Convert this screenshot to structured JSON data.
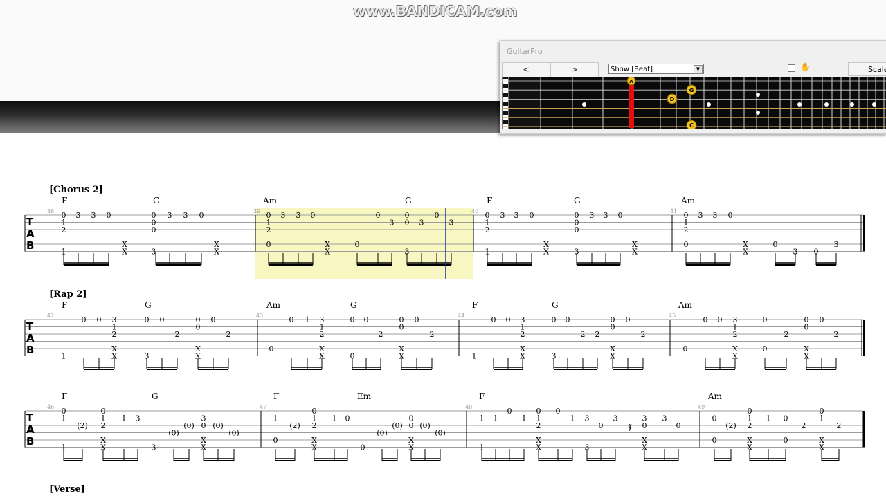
{
  "watermark": "www.BANDICAM.com",
  "guitarpro": {
    "title": "GuitarPro",
    "prev_label": "<",
    "next_label": ">",
    "view_select": "Show [Beat]",
    "scales_label": "Scales",
    "markers": [
      "A",
      "D",
      "G",
      "C"
    ]
  },
  "sections": {
    "chorus2": "[Chorus 2]",
    "rap2": "[Rap 2]",
    "verse": "[Verse]"
  },
  "tab_clef": [
    "T",
    "A",
    "B"
  ],
  "measure_numbers": [
    "38",
    "39",
    "40",
    "41",
    "42",
    "43",
    "44",
    "45",
    "46",
    "47",
    "48",
    "49"
  ],
  "chords": {
    "row1": [
      "F",
      "G",
      "Am",
      "G",
      "F",
      "G",
      "Am"
    ],
    "row2": [
      "F",
      "G",
      "Am",
      "G",
      "F",
      "G",
      "Am"
    ],
    "row3": [
      "F",
      "G",
      "F",
      "Em",
      "F",
      "Am"
    ]
  },
  "colors": {
    "highlight": "#f8f7c2",
    "cursor": "#2233aa",
    "marker": "#f0c020",
    "active_string": "#e01010"
  }
}
